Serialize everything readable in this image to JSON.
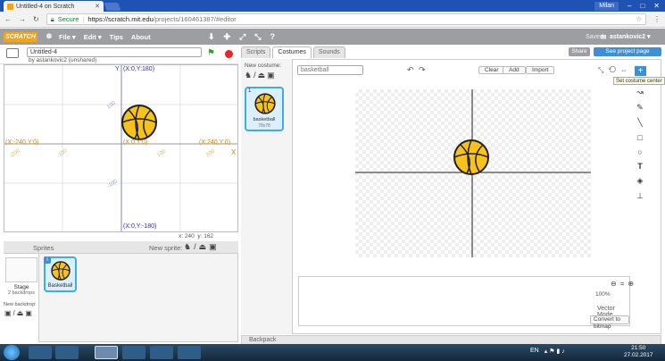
{
  "browser": {
    "tab_title": "Untitled-4 on Scratch",
    "user": "Milan",
    "secure_label": "Secure",
    "url_domain": "https://scratch.mit.edu",
    "url_path": "/projects/160461387/#editor"
  },
  "menubar": {
    "logo": "SCRATCH",
    "items": [
      "File",
      "Edit",
      "Tips",
      "About"
    ],
    "saved": "Saved",
    "account": "astankovic2"
  },
  "project": {
    "title": "Untitled-4",
    "byline": "by astankovic2 (unshared)"
  },
  "stage": {
    "labels": {
      "top": "(X:0,Y:180)",
      "bottom": "(X:0,Y:-180)",
      "left": "(X:-240,Y:0)",
      "right": "(X:240,Y:0)",
      "center": "(X:0,Y:0)",
      "x_axis": "X",
      "y_axis": "Y"
    },
    "ticks": [
      "-200",
      "-100",
      "100",
      "200",
      "100",
      "-100"
    ],
    "mouse_x": "x: 240",
    "mouse_y": "y: 162"
  },
  "sprites_panel": {
    "title": "Sprites",
    "new_sprite": "New sprite:",
    "stage_label": "Stage",
    "stage_backdrops": "2 backdrops",
    "new_backdrop": "New backdrop:",
    "sprite_name": "Basketball"
  },
  "editor": {
    "tabs": [
      "Scripts",
      "Costumes",
      "Sounds"
    ],
    "active_tab": "Costumes",
    "share": "Share",
    "see_page": "See project page",
    "new_costume": "New costume:",
    "costume_name": "basketball",
    "costume_size": "78x78",
    "costume_index": "1",
    "costume_field": "basketball",
    "clear": "Clear",
    "add": "Add",
    "import": "Import",
    "tooltip": "Set costume center",
    "zoom": "100%",
    "mode": "Vector Mode",
    "convert": "Convert to bitmap",
    "backpack": "Backpack"
  },
  "taskbar": {
    "lang": "EN",
    "time": "21:50",
    "date": "27.02.2017"
  },
  "colors": {
    "ball": "#f7c21a",
    "accent": "#3d8fd8",
    "stop": "#e22222",
    "flag": "#3a9b3a"
  }
}
